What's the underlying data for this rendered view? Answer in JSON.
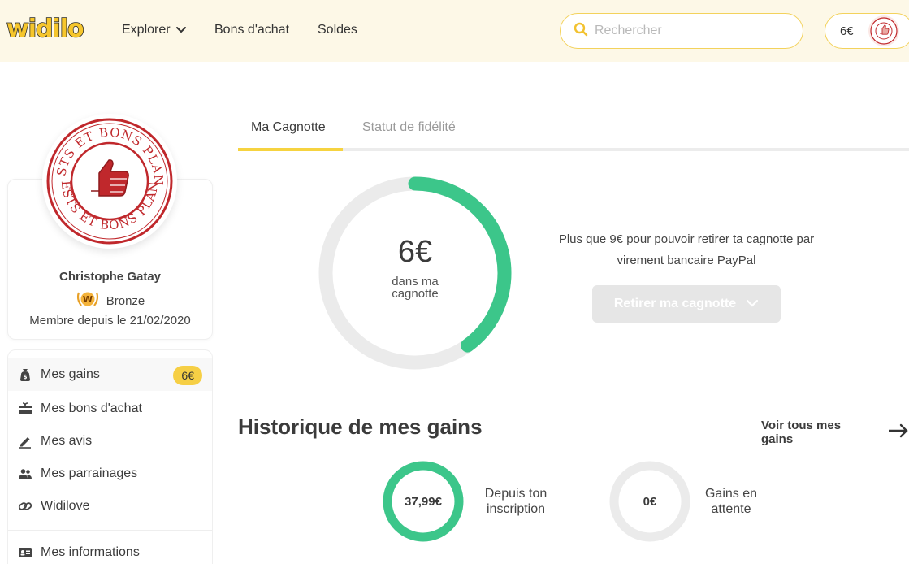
{
  "header": {
    "logo": "widilo",
    "nav": [
      {
        "label": "Explorer",
        "has_dropdown": true
      },
      {
        "label": "Bons d'achat"
      },
      {
        "label": "Soldes"
      }
    ],
    "search": {
      "placeholder": "Rechercher",
      "icon": "search-icon"
    },
    "wallet": {
      "amount": "6€",
      "avatar": "tests-et-bons-plans-stamp"
    }
  },
  "profile": {
    "name": "Christophe Gatay",
    "level": "Bronze",
    "level_badge": "W",
    "member_since": "Membre depuis le 21/02/2020",
    "avatar_text_top": "TESTS ET BONS PLANS",
    "avatar_text_bottom": "TESTS ET BONS PLANS"
  },
  "menu": {
    "items": [
      {
        "label": "Mes gains",
        "icon": "money-bag-icon",
        "badge": "6€",
        "active": true
      },
      {
        "label": "Mes bons d'achat",
        "icon": "gift-card-icon"
      },
      {
        "label": "Mes avis",
        "icon": "pen-icon"
      },
      {
        "label": "Mes parrainages",
        "icon": "users-icon"
      },
      {
        "label": "Widilove",
        "icon": "link-icon"
      },
      {
        "label": "Mes informations",
        "icon": "id-card-icon"
      }
    ]
  },
  "tabs": [
    {
      "label": "Ma Cagnotte",
      "active": true
    },
    {
      "label": "Statut de fidélité",
      "active": false
    }
  ],
  "cagnotte": {
    "amount": "6€",
    "caption": "dans ma cagnotte",
    "progress": 0.4,
    "info_line1": "Plus que 9€ pour pouvoir retirer ta cagnotte par",
    "info_line2": "virement bancaire PayPal",
    "withdraw_button": "Retirer ma cagnotte"
  },
  "history": {
    "title": "Historique de mes gains",
    "see_all": "Voir tous mes gains",
    "stats": [
      {
        "value": "37,99€",
        "caption_line1": "Depuis ton",
        "caption_line2": "inscription",
        "progress": 1.0
      },
      {
        "value": "0€",
        "caption_line1": "Gains en",
        "caption_line2": "attente",
        "progress": 0
      }
    ]
  },
  "colors": {
    "accent_yellow": "#f6d340",
    "header_bg": "#fdf8e7",
    "green": "#3cc68a",
    "track_gray": "#ebebeb",
    "stamp_red": "#c0282c"
  }
}
